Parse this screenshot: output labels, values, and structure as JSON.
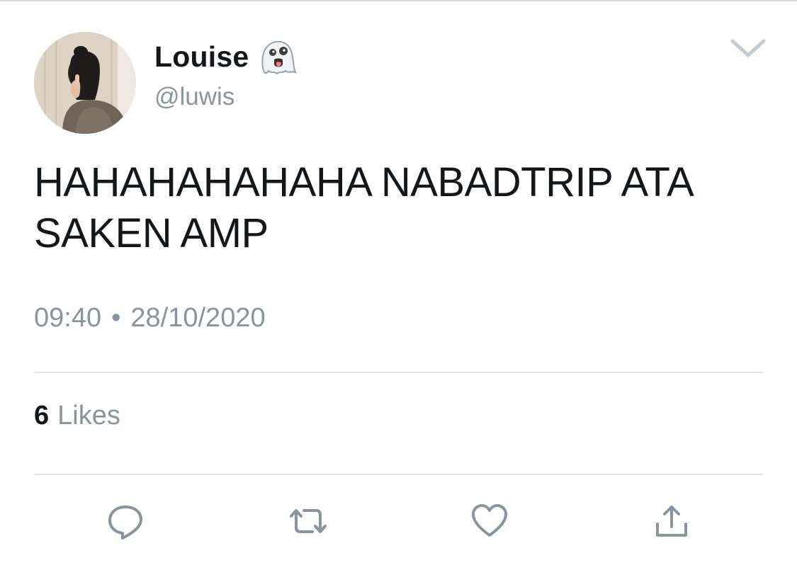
{
  "tweet": {
    "author": {
      "display_name": "Louise",
      "name_emoji_icon": "ghost-icon",
      "handle": "@luwis"
    },
    "text": "HAHAHAHAHAHA NABADTRIP ATA SAKEN AMP",
    "time": "09:40",
    "separator": "•",
    "date": "28/10/2020",
    "likes": {
      "count": "6",
      "label": "Likes"
    },
    "actions": [
      {
        "icon": "reply-icon"
      },
      {
        "icon": "retweet-icon"
      },
      {
        "icon": "heart-icon"
      },
      {
        "icon": "share-icon"
      }
    ]
  },
  "colors": {
    "text_primary": "#14171a",
    "text_secondary": "#8a949e",
    "icon_gray": "#8a949e",
    "divider": "#dfe3e6"
  }
}
